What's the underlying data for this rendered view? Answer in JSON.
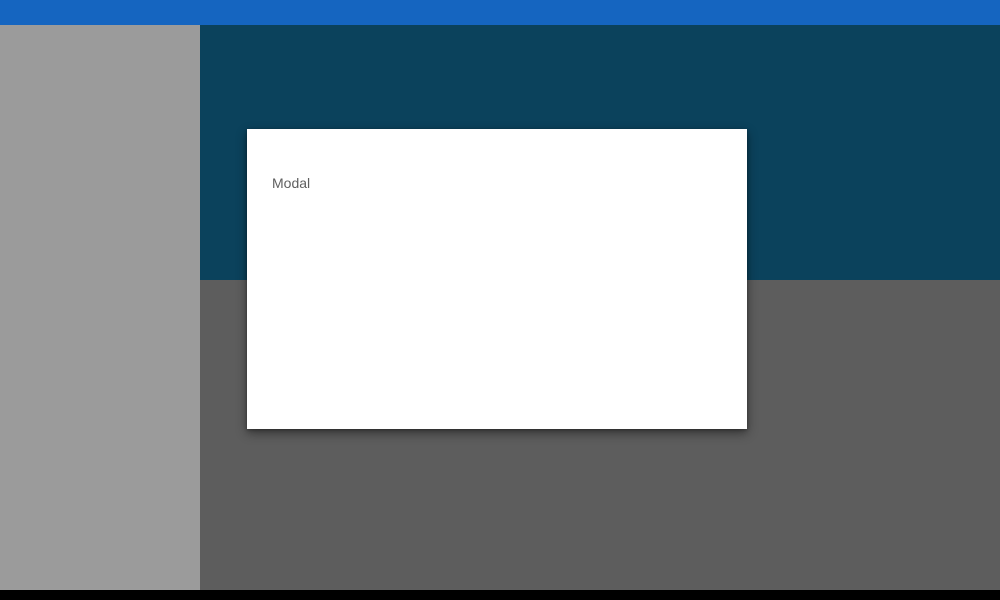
{
  "modal": {
    "title": "Modal"
  },
  "colors": {
    "top_bar": "#1565c0",
    "sidebar": "#9b9b9b",
    "main_background": "#5d5d5d",
    "hero_band": "#0b425c",
    "modal_background": "#ffffff",
    "modal_text": "#5f5f5f"
  }
}
